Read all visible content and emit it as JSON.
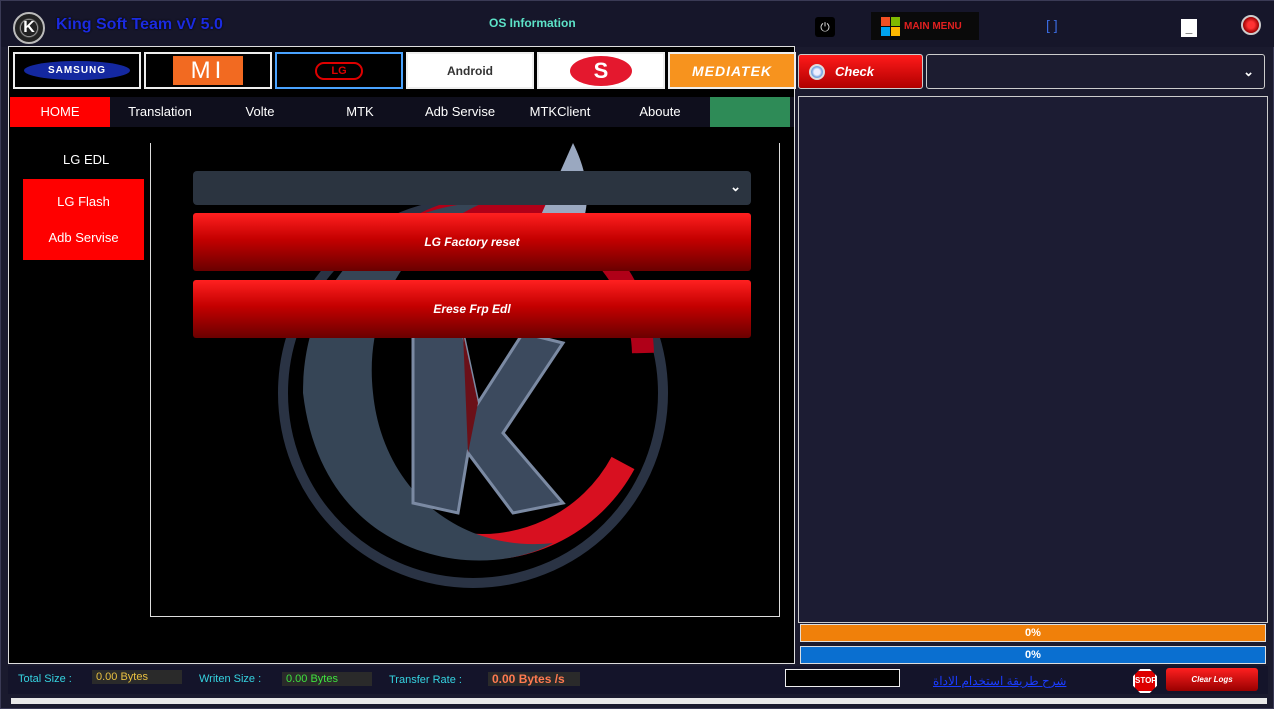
{
  "titlebar": {
    "logo_letter": "K",
    "app_title": "King Soft Team vV 5.0",
    "os_info": "OS Information",
    "power_glyph": "⏻",
    "main_menu_label": "MAIN MENU",
    "maximize_glyph": "[ ]",
    "minimize_glyph": "_"
  },
  "brands": [
    {
      "label": "SAMSUNG"
    },
    {
      "label": "MI"
    },
    {
      "label": "LG"
    },
    {
      "label": "Android"
    },
    {
      "label": "S"
    },
    {
      "label": "MEDIATEK"
    }
  ],
  "nav": {
    "items": [
      "HOME",
      "Translation",
      "Volte",
      "MTK",
      "Adb Servise",
      "MTKClient",
      "Aboute",
      ""
    ]
  },
  "sidebar": {
    "title": "LG EDL",
    "items": [
      "LG Flash",
      "Adb Servise"
    ]
  },
  "content": {
    "select_value": "",
    "buttons": [
      "LG Factory reset",
      "Erese Frp Edl"
    ]
  },
  "right_panel": {
    "check_label": "Check",
    "port_value": "",
    "progress": [
      {
        "label": "0%",
        "value": 0,
        "color": "#f0800a"
      },
      {
        "label": "0%",
        "value": 0,
        "color": "#0a6fd0"
      }
    ]
  },
  "statusbar": {
    "total_size_label": "Total Size :",
    "total_size_value": "0.00 Bytes",
    "writen_size_label": "Writen Size :",
    "writen_size_value": "0.00 Bytes",
    "transfer_rate_label": "Transfer Rate :",
    "transfer_rate_value": "0.00 Bytes /s",
    "arabic_link": "شرح طريقة استخدام الاداة",
    "stop_label": "STOP",
    "clear_logs_label": "Clear Logs"
  },
  "icons": {
    "chevron": "chevron-down-icon",
    "search": "magnifier-icon",
    "windows": "windows-logo-icon",
    "stop": "stop-sign-icon"
  }
}
